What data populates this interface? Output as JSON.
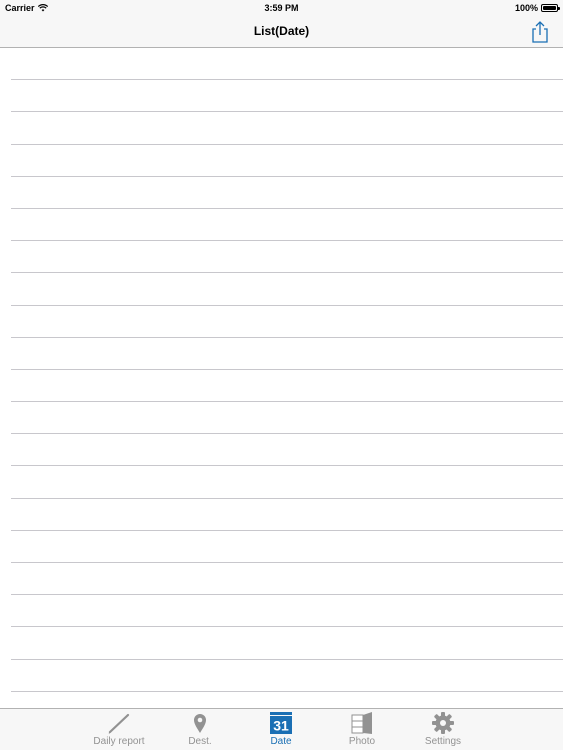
{
  "status_bar": {
    "carrier": "Carrier",
    "time": "3:59 PM",
    "battery": "100%"
  },
  "nav_bar": {
    "title": "List(Date)",
    "share_icon": "share-icon"
  },
  "list": {
    "row_count": 20
  },
  "tab_bar": {
    "active_color": "#1a6fb4",
    "inactive_color": "#929292",
    "tabs": [
      {
        "label": "Daily report",
        "icon": "pencil-icon"
      },
      {
        "label": "Dest.",
        "icon": "map-pin-icon"
      },
      {
        "label": "Date",
        "icon": "calendar-icon",
        "calendar_day": "31",
        "active": true
      },
      {
        "label": "Photo",
        "icon": "photo-book-icon"
      },
      {
        "label": "Settings",
        "icon": "gear-icon"
      }
    ]
  }
}
